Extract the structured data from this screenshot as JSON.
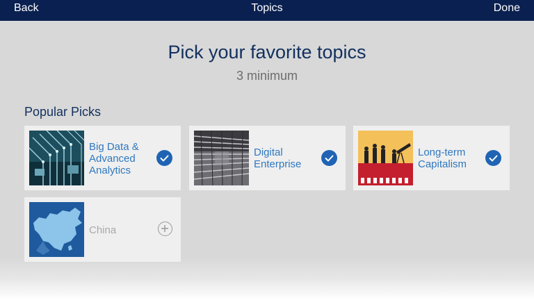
{
  "nav": {
    "back_label": "Back",
    "title": "Topics",
    "done_label": "Done"
  },
  "header": {
    "title": "Pick your favorite topics",
    "subtitle": "3 minimum"
  },
  "section": {
    "title": "Popular Picks"
  },
  "topics": [
    {
      "label": "Big Data &\nAdvanced\nAnalytics",
      "selected": true,
      "thumb_icon": "circuit-board-image"
    },
    {
      "label": "Digital\nEnterprise",
      "selected": true,
      "thumb_icon": "server-rack-image"
    },
    {
      "label": "Long-term\nCapitalism",
      "selected": true,
      "thumb_icon": "businesspeople-telescope-image"
    },
    {
      "label": "China",
      "selected": false,
      "thumb_icon": "china-map-image"
    }
  ],
  "colors": {
    "navbar": "#0a2050",
    "accent": "#1f64b4",
    "heading": "#12305e",
    "link": "#2f78bf"
  }
}
